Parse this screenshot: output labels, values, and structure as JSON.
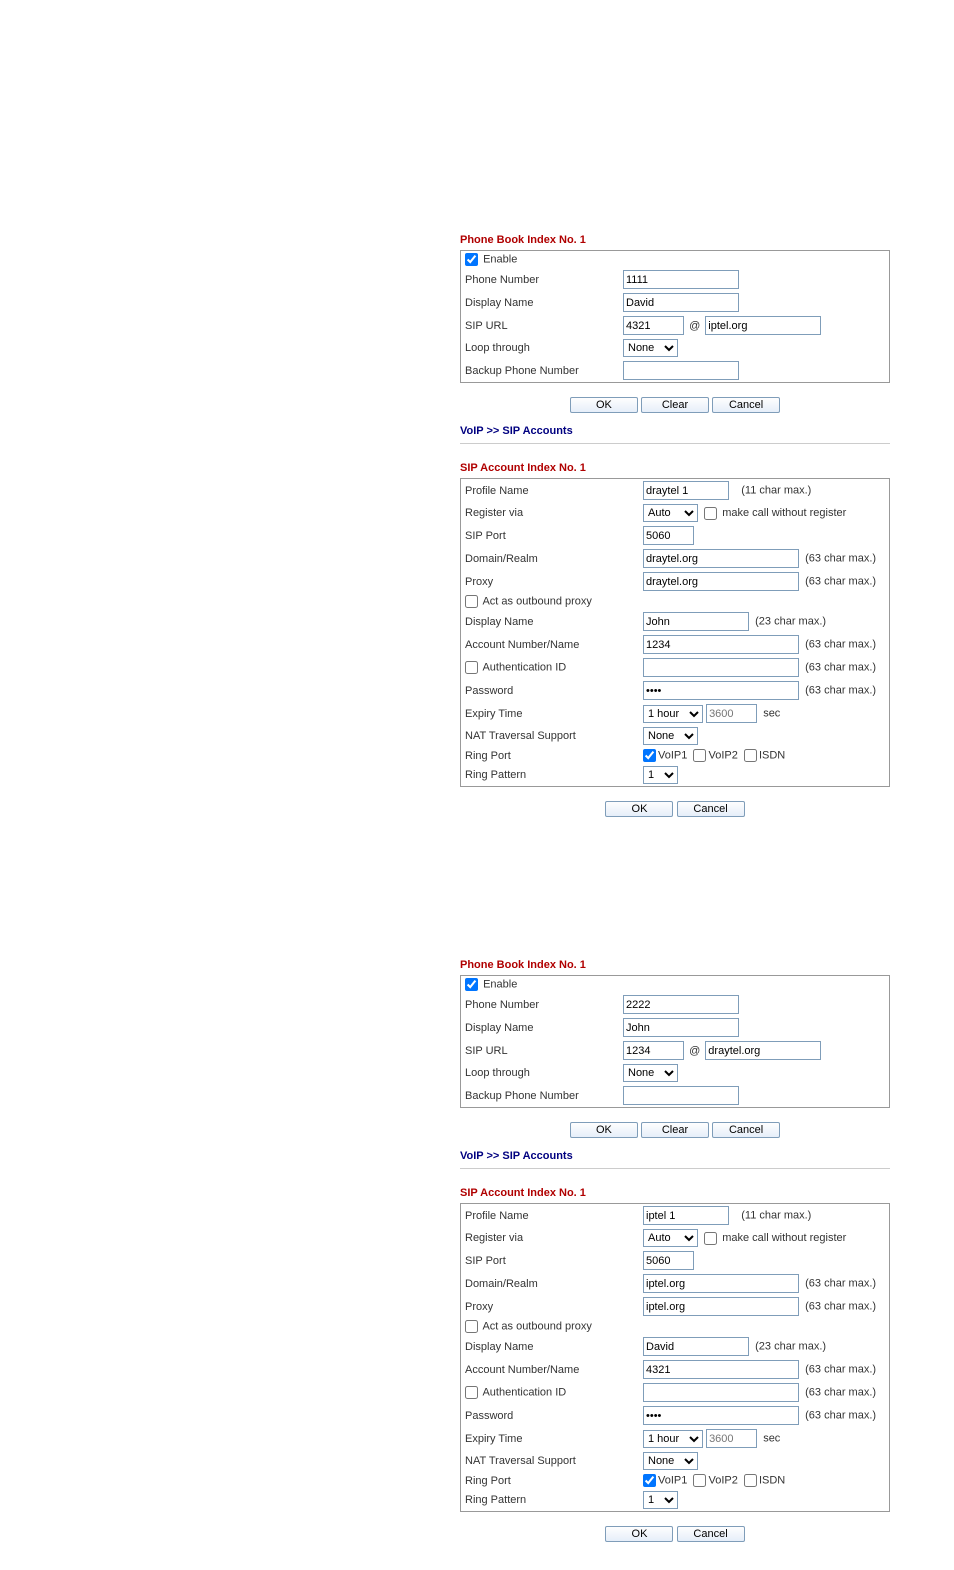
{
  "phonebook1": {
    "title": "Phone Book Index No. 1",
    "enable_label": "Enable",
    "enable_checked": true,
    "fields": {
      "phone_number": {
        "label": "Phone Number",
        "value": "1111"
      },
      "display_name": {
        "label": "Display Name",
        "value": "David"
      },
      "sip_url": {
        "label": "SIP URL",
        "user": "4321",
        "domain": "iptel.org"
      },
      "loop_through": {
        "label": "Loop through",
        "value": "None"
      },
      "backup": {
        "label": "Backup Phone Number",
        "value": ""
      }
    },
    "buttons": {
      "ok": "OK",
      "clear": "Clear",
      "cancel": "Cancel"
    }
  },
  "sip_breadcrumb": "VoIP >> SIP Accounts",
  "sipacct1": {
    "title": "SIP Account Index No. 1",
    "profile_name": {
      "label": "Profile Name",
      "value": "draytel 1",
      "hint": "(11 char max.)"
    },
    "register_via": {
      "label": "Register via",
      "value": "Auto",
      "make_call_label": "make call without register",
      "make_call_checked": false
    },
    "sip_port": {
      "label": "SIP Port",
      "value": "5060"
    },
    "domain": {
      "label": "Domain/Realm",
      "value": "draytel.org",
      "hint": "(63 char max.)"
    },
    "proxy": {
      "label": "Proxy",
      "value": "draytel.org",
      "hint": "(63 char max.)"
    },
    "outbound": {
      "label": "Act as outbound proxy",
      "checked": false
    },
    "display_name": {
      "label": "Display Name",
      "value": "John",
      "hint": "(23 char max.)"
    },
    "account": {
      "label": "Account Number/Name",
      "value": "1234",
      "hint": "(63 char max.)"
    },
    "auth_id": {
      "label": "Authentication ID",
      "value": "",
      "hint": "(63 char max.)",
      "checked": false
    },
    "password": {
      "label": "Password",
      "value": "••••",
      "hint": "(63 char max.)"
    },
    "expiry": {
      "label": "Expiry Time",
      "select": "1 hour",
      "seconds": "3600",
      "unit": "sec"
    },
    "nat": {
      "label": "NAT Traversal Support",
      "value": "None"
    },
    "ring_port": {
      "label": "Ring Port",
      "voip1": "VoIP1",
      "voip1_checked": true,
      "voip2": "VoIP2",
      "voip2_checked": false,
      "isdn": "ISDN",
      "isdn_checked": false
    },
    "ring_pattern": {
      "label": "Ring Pattern",
      "value": "1"
    },
    "buttons": {
      "ok": "OK",
      "cancel": "Cancel"
    }
  },
  "phonebook2": {
    "title": "Phone Book Index No. 1",
    "enable_label": "Enable",
    "enable_checked": true,
    "fields": {
      "phone_number": {
        "label": "Phone Number",
        "value": "2222"
      },
      "display_name": {
        "label": "Display Name",
        "value": "John"
      },
      "sip_url": {
        "label": "SIP URL",
        "user": "1234",
        "domain": "draytel.org"
      },
      "loop_through": {
        "label": "Loop through",
        "value": "None"
      },
      "backup": {
        "label": "Backup Phone Number",
        "value": ""
      }
    },
    "buttons": {
      "ok": "OK",
      "clear": "Clear",
      "cancel": "Cancel"
    }
  },
  "sipacct2": {
    "title": "SIP Account Index No. 1",
    "profile_name": {
      "label": "Profile Name",
      "value": "iptel 1",
      "hint": "(11 char max.)"
    },
    "register_via": {
      "label": "Register via",
      "value": "Auto",
      "make_call_label": "make call without register",
      "make_call_checked": false
    },
    "sip_port": {
      "label": "SIP Port",
      "value": "5060"
    },
    "domain": {
      "label": "Domain/Realm",
      "value": "iptel.org",
      "hint": "(63 char max.)"
    },
    "proxy": {
      "label": "Proxy",
      "value": "iptel.org",
      "hint": "(63 char max.)"
    },
    "outbound": {
      "label": "Act as outbound proxy",
      "checked": false
    },
    "display_name": {
      "label": "Display Name",
      "value": "David",
      "hint": "(23 char max.)"
    },
    "account": {
      "label": "Account Number/Name",
      "value": "4321",
      "hint": "(63 char max.)"
    },
    "auth_id": {
      "label": "Authentication ID",
      "value": "",
      "hint": "(63 char max.)",
      "checked": false
    },
    "password": {
      "label": "Password",
      "value": "••••",
      "hint": "(63 char max.)"
    },
    "expiry": {
      "label": "Expiry Time",
      "select": "1 hour",
      "seconds": "3600",
      "unit": "sec"
    },
    "nat": {
      "label": "NAT Traversal Support",
      "value": "None"
    },
    "ring_port": {
      "label": "Ring Port",
      "voip1": "VoIP1",
      "voip1_checked": true,
      "voip2": "VoIP2",
      "voip2_checked": false,
      "isdn": "ISDN",
      "isdn_checked": false
    },
    "ring_pattern": {
      "label": "Ring Pattern",
      "value": "1"
    },
    "buttons": {
      "ok": "OK",
      "cancel": "Cancel"
    }
  }
}
